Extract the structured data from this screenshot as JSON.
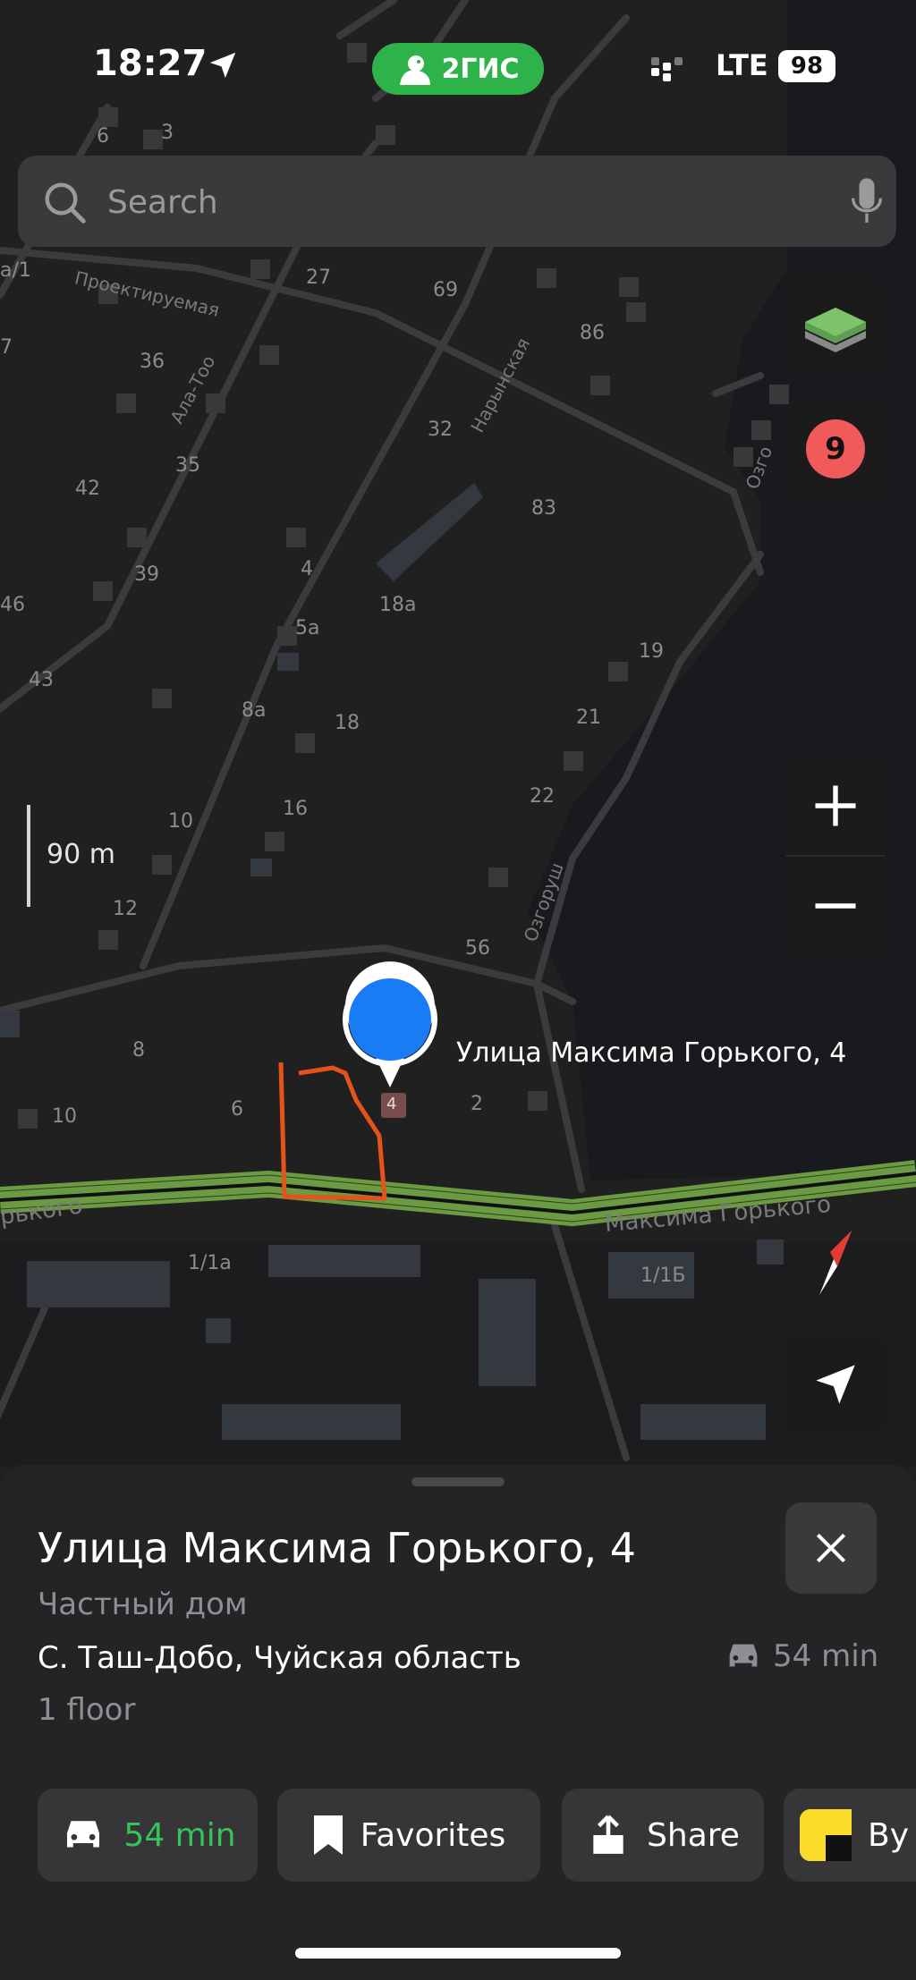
{
  "status_bar": {
    "time": "18:27",
    "app_name": "2ГИС",
    "network": "LTE",
    "battery": "98"
  },
  "search": {
    "placeholder": "Search"
  },
  "map": {
    "scale": "90 m",
    "selected_label": "Улица Максима Горького, 4",
    "traffic_level": "9",
    "streets": [
      "Проектируемая",
      "Ала-Тоо",
      "Нарынская",
      "Озгоруш",
      "Озго",
      "Максима Горького",
      "рького"
    ],
    "house_numbers": [
      "6",
      "3",
      "27",
      "69",
      "86",
      "36",
      "32",
      "35",
      "42",
      "83",
      "39",
      "4",
      "5а",
      "18а",
      "19",
      "43",
      "8а",
      "18",
      "21",
      "16",
      "22",
      "10",
      "12",
      "56",
      "8",
      "6",
      "4",
      "2",
      "10",
      "1/1а",
      "1/1Б",
      "а/1",
      "7",
      "46"
    ]
  },
  "sheet": {
    "title": "Улица Максима Горького, 4",
    "category": "Частный дом",
    "address": "С. Таш-Добо, Чуйская область",
    "travel_time": "54 min",
    "floors": "1 floor",
    "actions": {
      "route": "54 min",
      "favorites": "Favorites",
      "share": "Share",
      "yandex": "By"
    }
  },
  "colors": {
    "accent_green": "#2eb24a",
    "pin_blue": "#1a7cf5",
    "traffic_red": "#f05a5a",
    "road_green": "#6b9a43",
    "drawn_outline": "#e5531a"
  }
}
